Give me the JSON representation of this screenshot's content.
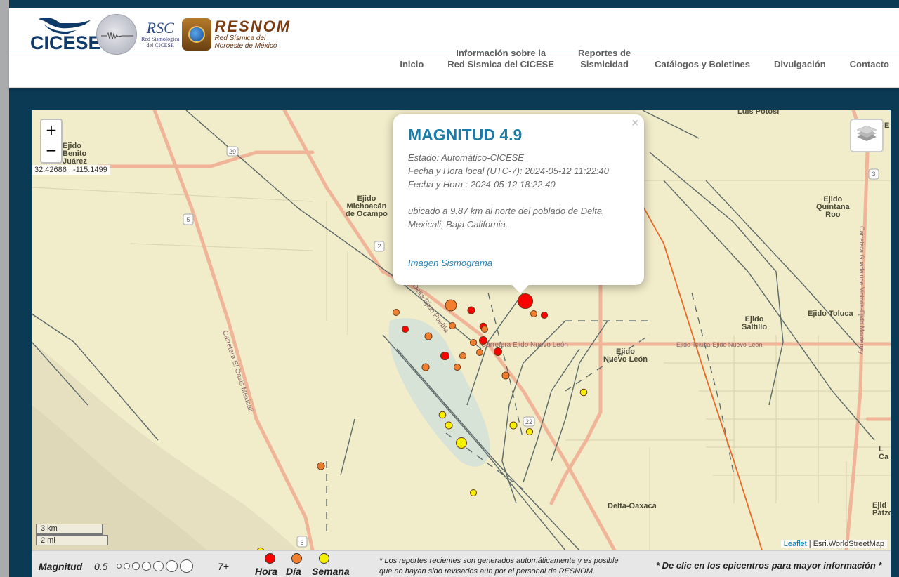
{
  "header": {
    "logos": {
      "cicese": "CICESE",
      "rsc_title": "RSC",
      "rsc_subtitle_1": "Red Sismológica",
      "rsc_subtitle_2": "del CICESE",
      "resnom_title": "RESNOM",
      "resnom_subtitle_1": "Red Sísmica del",
      "resnom_subtitle_2": "Noroeste de México"
    },
    "nav": [
      {
        "line1": "",
        "line2": "Inicio"
      },
      {
        "line1": "Información sobre la",
        "line2": "Red Sismica del CICESE"
      },
      {
        "line1": "Reportes de",
        "line2": "Sismicidad"
      },
      {
        "line1": "",
        "line2": "Catálogos y Boletines"
      },
      {
        "line1": "",
        "line2": "Divulgación"
      },
      {
        "line1": "",
        "line2": "Contacto"
      }
    ]
  },
  "map": {
    "zoom_in": "+",
    "zoom_out": "−",
    "cursor_coords": "32.42686 : -115.1499",
    "layers_icon": "layers-icon",
    "scale_km": "3 km",
    "scale_mi": "2 mi",
    "attribution_link": "Leaflet",
    "attribution_sep": " | ",
    "attribution_source": "Esri.WorldStreetMap",
    "labels": {
      "benito_juarez": "Ejido\nBenito\nJuárez",
      "michoacan": "Ejido\nMichoacán\nde Ocampo",
      "quintana_roo": "Ejido\nQuintana\nRoo",
      "saltillo": "Ejido\nSaltillo",
      "toluca": "Ejido Toluca",
      "nuevo_leon": "Ejido\nNuevo León",
      "delta_oaxaca": "Delta-Oaxaca",
      "luis_potosi": "Luis Potosí",
      "patzcuaro": "Ejid\nPátzc",
      "right_edge_1": "E",
      "right_edge_2": "L\nCa",
      "road_delta_puebla": "Delta Ejido Puebla",
      "road_nuevo_leon": "Carretera Ejido Nuevo León",
      "road_toluca": "Ejido Toluca-Ejido Nuevo León",
      "road_oasis": "Carretera El Oasis Mexicali",
      "road_guadalupe": "Carretera Guadalupe Victoria-Ejido Monterrey",
      "shield_29": "29",
      "shield_5a": "5",
      "shield_5b": "5",
      "shield_2": "2",
      "shield_3": "3",
      "shield_22": "22"
    },
    "colors": {
      "hora": "#ff0000",
      "dia": "#f08030",
      "semana": "#f5f000"
    },
    "epicenters": [
      {
        "period": "hora",
        "mag": 4.9,
        "selected": true
      },
      {
        "period": "hora",
        "mag": 2.6
      },
      {
        "period": "hora",
        "mag": 2.4
      },
      {
        "period": "hora",
        "mag": 2.5
      },
      {
        "period": "hora",
        "mag": 2.8
      },
      {
        "period": "hora",
        "mag": 2.8
      },
      {
        "period": "hora",
        "mag": 2.8
      },
      {
        "period": "hora",
        "mag": 2.4
      },
      {
        "period": "hora",
        "mag": 2.8
      },
      {
        "period": "dia",
        "mag": 3.8
      },
      {
        "period": "dia",
        "mag": 2.3
      },
      {
        "period": "dia",
        "mag": 2.3
      },
      {
        "period": "dia",
        "mag": 2.3
      },
      {
        "period": "dia",
        "mag": 2.6
      },
      {
        "period": "dia",
        "mag": 2.4
      },
      {
        "period": "dia",
        "mag": 2.3
      },
      {
        "period": "dia",
        "mag": 2.3
      },
      {
        "period": "dia",
        "mag": 2.6
      },
      {
        "period": "dia",
        "mag": 2.4
      },
      {
        "period": "dia",
        "mag": 2.6
      },
      {
        "period": "dia",
        "mag": 2.3
      },
      {
        "period": "dia",
        "mag": 2.6
      },
      {
        "period": "semana",
        "mag": 2.5
      },
      {
        "period": "semana",
        "mag": 2.5
      },
      {
        "period": "semana",
        "mag": 2.6
      },
      {
        "period": "semana",
        "mag": 3.6
      },
      {
        "period": "semana",
        "mag": 2.6
      },
      {
        "period": "semana",
        "mag": 2.4
      },
      {
        "period": "semana",
        "mag": 2.3
      },
      {
        "period": "semana",
        "mag": 2.5
      }
    ]
  },
  "popup": {
    "close": "×",
    "title": "MAGNITUD 4.9",
    "estado": "Estado: Automático-CICESE",
    "fecha_local": "Fecha y Hora local (UTC-7): 2024-05-12 11:22:40",
    "fecha_utc": "Fecha y Hora : 2024-05-12 18:22:40",
    "ubicacion_1": "ubicado a 9.87 km al norte del poblado de Delta,",
    "ubicacion_2": "Mexicali, Baja California.",
    "link": "Imagen Sismograma"
  },
  "legend": {
    "magnitud": "Magnitud",
    "min": "0.5",
    "max": "7+",
    "hora": "Hora",
    "dia": "Día",
    "semana": "Semana",
    "note_1": "* Los reportes recientes son generados automáticamente y es posible",
    "note_2": "que no hayan sido revisados aún por el personal de RESNOM.",
    "click_hint": "* De clic en los epicentros para mayor información *"
  }
}
